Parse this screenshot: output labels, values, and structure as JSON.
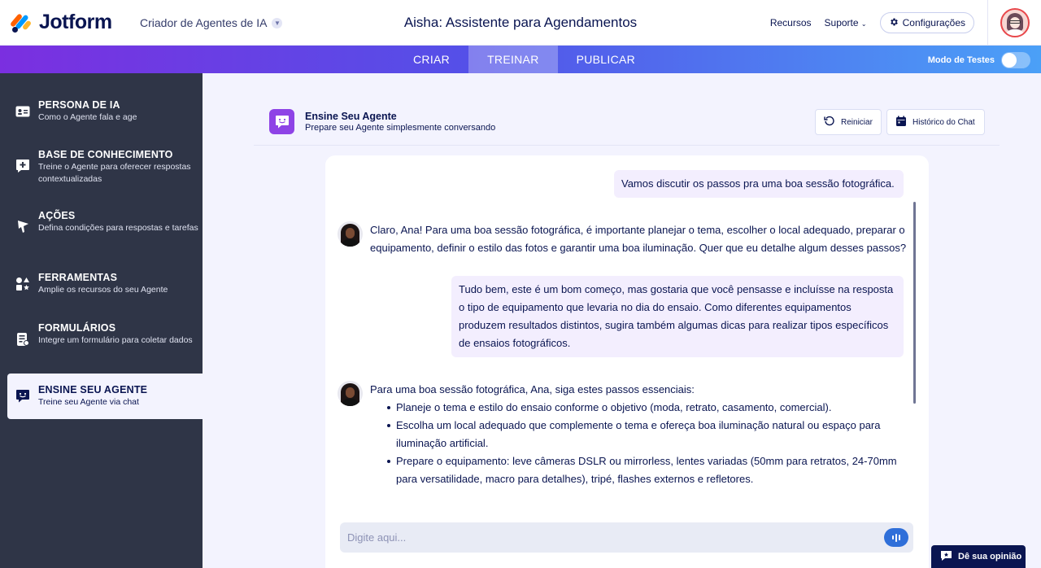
{
  "header": {
    "brand": "Jotform",
    "product_selector": "Criador de Agentes de IA",
    "title": "Aisha: Assistente para Agendamentos",
    "links": {
      "resources": "Recursos",
      "support": "Suporte",
      "settings": "Configurações"
    }
  },
  "tabs": {
    "create": "CRIAR",
    "train": "TREINAR",
    "publish": "PUBLICAR",
    "active": "TREINAR"
  },
  "test_mode": {
    "label": "Modo de Testes",
    "enabled": false
  },
  "sidebar": {
    "items": [
      {
        "title": "PERSONA DE IA",
        "desc": "Como o Agente fala e age",
        "icon": "id-card-icon"
      },
      {
        "title": "BASE DE CONHECIMENTO",
        "desc": "Treine o Agente para oferecer respostas contextualizadas",
        "icon": "knowledge-base-icon"
      },
      {
        "title": "AÇÕES",
        "desc": "Defina condições para respostas e tarefas",
        "icon": "flag-icon"
      },
      {
        "title": "FERRAMENTAS",
        "desc": "Amplie os recursos do seu Agente",
        "icon": "shapes-icon"
      },
      {
        "title": "FORMULÁRIOS",
        "desc": "Integre um formulário para coletar dados",
        "icon": "form-icon"
      },
      {
        "title": "ENSINE SEU AGENTE",
        "desc": "Treine seu Agente via chat",
        "icon": "chat-teach-icon",
        "active": true
      }
    ]
  },
  "section": {
    "title": "Ensine Seu Agente",
    "subtitle": "Prepare seu Agente simplesmente conversando",
    "restart_label": "Reiniciar",
    "history_label": "Histórico do Chat"
  },
  "chat": {
    "messages": [
      {
        "role": "user",
        "text": "Vamos discutir os passos pra uma boa sessão fotográfica."
      },
      {
        "role": "agent",
        "text": "Claro, Ana! Para uma boa sessão fotográfica, é importante planejar o tema, escolher o local adequado, preparar o equipamento, definir o estilo das fotos e garantir uma boa iluminação. Quer que eu detalhe algum desses passos?"
      },
      {
        "role": "user",
        "text": "Tudo bem, este é um bom começo, mas gostaria que você pensasse e incluísse na resposta o tipo de equipamento que levaria no dia do ensaio. Como diferentes equipamentos produzem resultados distintos, sugira também algumas dicas para realizar tipos específicos de ensaios fotográficos."
      },
      {
        "role": "agent",
        "text": "Para uma boa sessão fotográfica, Ana, siga estes passos essenciais:",
        "bullets": [
          "Planeje o tema e estilo do ensaio conforme o objetivo (moda, retrato, casamento, comercial).",
          "Escolha um local adequado que complemente o tema e ofereça boa iluminação natural ou espaço para iluminação artificial.",
          "Prepare o equipamento: leve câmeras DSLR ou mirrorless, lentes variadas (50mm para retratos, 24-70mm para versatilidade, macro para detalhes), tripé, flashes externos e refletores."
        ]
      }
    ],
    "input_placeholder": "Digite aqui..."
  },
  "feedback": {
    "label": "Dê sua opinião"
  },
  "colors": {
    "accent_purple": "#8e43e6",
    "sidebar_bg": "#2f3547",
    "navy": "#0a1551",
    "voice_blue": "#2f6fd9"
  }
}
